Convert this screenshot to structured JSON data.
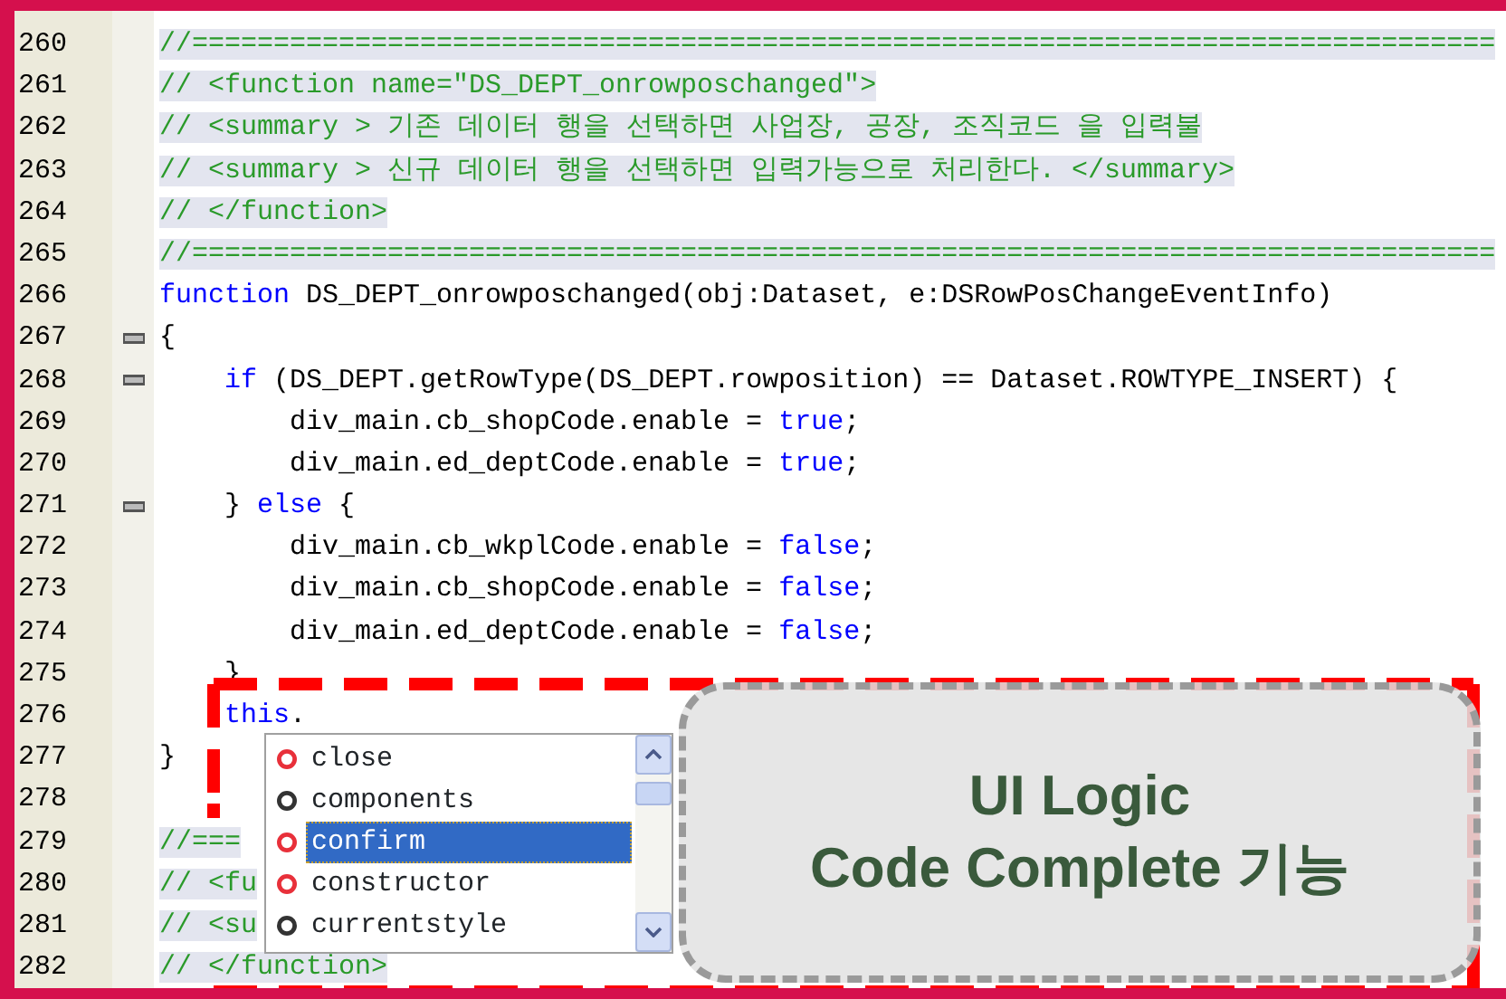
{
  "editor": {
    "lines": [
      {
        "number": "260",
        "collapsible": false,
        "segments": [
          [
            {
              "kind": "comment",
              "text": "//================================================================================"
            }
          ]
        ]
      },
      {
        "number": "261",
        "collapsible": false,
        "segments": [
          [
            {
              "kind": "comment",
              "text": "// <function name=\"DS_DEPT_onrowposchanged\">"
            }
          ]
        ]
      },
      {
        "number": "262",
        "collapsible": false,
        "segments": [
          [
            {
              "kind": "comment",
              "text": "// <summary > 기존 데이터 행을 선택하면 사업장, 공장, 조직코드 을 입력불"
            }
          ]
        ]
      },
      {
        "number": "263",
        "collapsible": false,
        "segments": [
          [
            {
              "kind": "comment",
              "text": "// <summary > 신규 데이터 행을 선택하면 입력가능으로 처리한다. </summary>"
            }
          ]
        ]
      },
      {
        "number": "264",
        "collapsible": false,
        "segments": [
          [
            {
              "kind": "comment",
              "text": "// </function>"
            }
          ]
        ]
      },
      {
        "number": "265",
        "collapsible": false,
        "segments": [
          [
            {
              "kind": "comment",
              "text": "//================================================================================"
            }
          ]
        ]
      },
      {
        "number": "266",
        "collapsible": false,
        "segments": [
          [
            {
              "kind": "keyword",
              "text": "function"
            },
            {
              "kind": "plain",
              "text": " DS_DEPT_onrowposchanged(obj:Dataset, e:DSRowPosChangeEventInfo)"
            }
          ]
        ]
      },
      {
        "number": "267",
        "collapsible": true,
        "segments": [
          [
            {
              "kind": "plain",
              "text": "{"
            }
          ]
        ]
      },
      {
        "number": "268",
        "collapsible": true,
        "segments": [
          [
            {
              "kind": "keyword",
              "text": "    if"
            },
            {
              "kind": "plain",
              "text": " (DS_DEPT.getRowType(DS_DEPT.rowposition) == Dataset.ROWTYPE_INSERT) {"
            }
          ]
        ]
      },
      {
        "number": "269",
        "collapsible": false,
        "segments": [
          [
            {
              "kind": "plain",
              "text": "        div_main.cb_shopCode.enable = "
            },
            {
              "kind": "keyword",
              "text": "true"
            },
            {
              "kind": "plain",
              "text": ";"
            }
          ]
        ]
      },
      {
        "number": "270",
        "collapsible": false,
        "segments": [
          [
            {
              "kind": "plain",
              "text": "        div_main.ed_deptCode.enable = "
            },
            {
              "kind": "keyword",
              "text": "true"
            },
            {
              "kind": "plain",
              "text": ";"
            }
          ]
        ]
      },
      {
        "number": "271",
        "collapsible": true,
        "segments": [
          [
            {
              "kind": "plain",
              "text": "    } "
            },
            {
              "kind": "keyword",
              "text": "else"
            },
            {
              "kind": "plain",
              "text": " {"
            }
          ]
        ]
      },
      {
        "number": "272",
        "collapsible": false,
        "segments": [
          [
            {
              "kind": "plain",
              "text": "        div_main.cb_wkplCode.enable = "
            },
            {
              "kind": "keyword",
              "text": "false"
            },
            {
              "kind": "plain",
              "text": ";"
            }
          ]
        ]
      },
      {
        "number": "273",
        "collapsible": false,
        "segments": [
          [
            {
              "kind": "plain",
              "text": "        div_main.cb_shopCode.enable = "
            },
            {
              "kind": "keyword",
              "text": "false"
            },
            {
              "kind": "plain",
              "text": ";"
            }
          ]
        ]
      },
      {
        "number": "274",
        "collapsible": false,
        "segments": [
          [
            {
              "kind": "plain",
              "text": "        div_main.ed_deptCode.enable = "
            },
            {
              "kind": "keyword",
              "text": "false"
            },
            {
              "kind": "plain",
              "text": ";"
            }
          ]
        ]
      },
      {
        "number": "275",
        "collapsible": false,
        "segments": [
          [
            {
              "kind": "plain",
              "text": "    }"
            }
          ]
        ]
      },
      {
        "number": "276",
        "collapsible": false,
        "segments": [
          [
            {
              "kind": "keyword",
              "text": "    this"
            },
            {
              "kind": "plain",
              "text": "."
            }
          ]
        ]
      },
      {
        "number": "277",
        "collapsible": false,
        "segments": [
          [
            {
              "kind": "plain",
              "text": "}"
            }
          ]
        ]
      },
      {
        "number": "278",
        "collapsible": false
      },
      {
        "number": "279",
        "collapsible": false,
        "segments": [
          [
            {
              "kind": "comment",
              "text": "//==="
            }
          ]
        ]
      },
      {
        "number": "280",
        "collapsible": false,
        "segments": [
          [
            {
              "kind": "comment",
              "text": "// <fu"
            }
          ]
        ]
      },
      {
        "number": "281",
        "collapsible": false,
        "segments": [
          [
            {
              "kind": "comment",
              "text": "// <su"
            }
          ]
        ]
      },
      {
        "number": "282",
        "collapsible": false,
        "segments": [
          [
            {
              "kind": "comment",
              "text": "// </function>"
            }
          ]
        ]
      }
    ]
  },
  "autocomplete": {
    "items": [
      {
        "label": "close",
        "kind": "method",
        "selected": false
      },
      {
        "label": "components",
        "kind": "property",
        "selected": false
      },
      {
        "label": "confirm",
        "kind": "method",
        "selected": true
      },
      {
        "label": "constructor",
        "kind": "method",
        "selected": false
      },
      {
        "label": "currentstyle",
        "kind": "property",
        "selected": false
      }
    ]
  },
  "callout": {
    "lines": [
      "UI Logic",
      "Code Complete 기능"
    ]
  }
}
